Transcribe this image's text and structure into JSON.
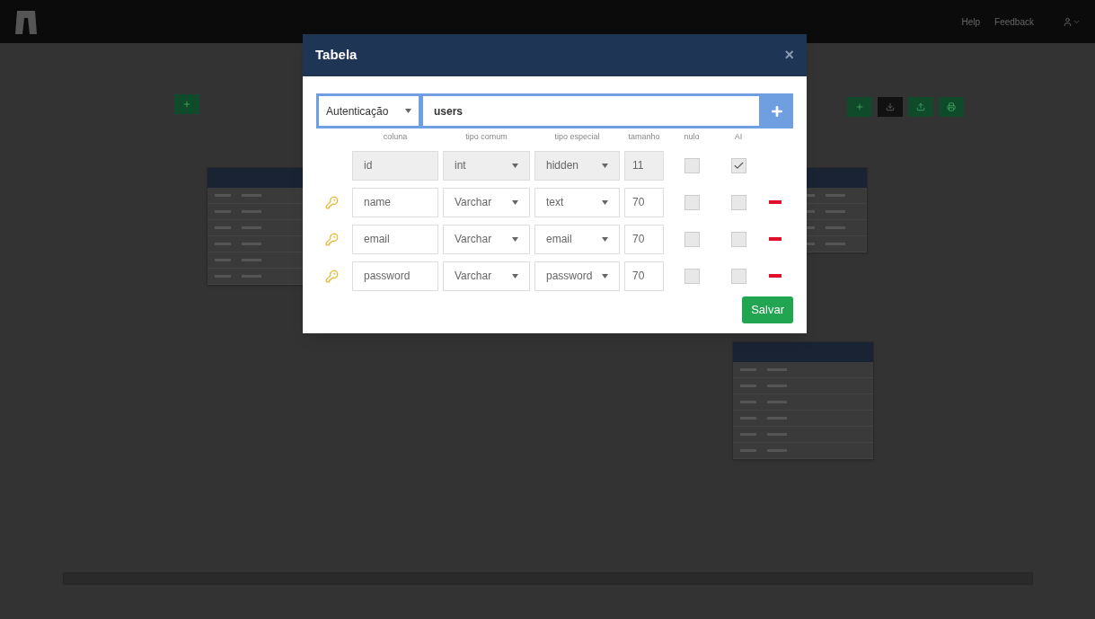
{
  "navbar": {
    "links": [
      "Help",
      "Feedback"
    ]
  },
  "modal": {
    "title": "Tabela",
    "close": "×",
    "module": "Autenticação",
    "table_name": "users",
    "headers": [
      "coluna",
      "tipo comum",
      "tipo especial",
      "tamanho",
      "nulo",
      "AI"
    ],
    "rows": [
      {
        "column": "id",
        "common_type": "int",
        "special_type": "hidden",
        "size": "11",
        "disabled": true,
        "nullable": false,
        "auto_increment": true
      },
      {
        "column": "name",
        "common_type": "Varchar",
        "special_type": "text",
        "size": "70",
        "disabled": false,
        "nullable": false,
        "auto_increment": false
      },
      {
        "column": "email",
        "common_type": "Varchar",
        "special_type": "email",
        "size": "70",
        "disabled": false,
        "nullable": false,
        "auto_increment": false
      },
      {
        "column": "password",
        "common_type": "Varchar",
        "special_type": "password",
        "size": "70",
        "disabled": false,
        "nullable": false,
        "auto_increment": false
      }
    ],
    "save": "Salvar"
  }
}
